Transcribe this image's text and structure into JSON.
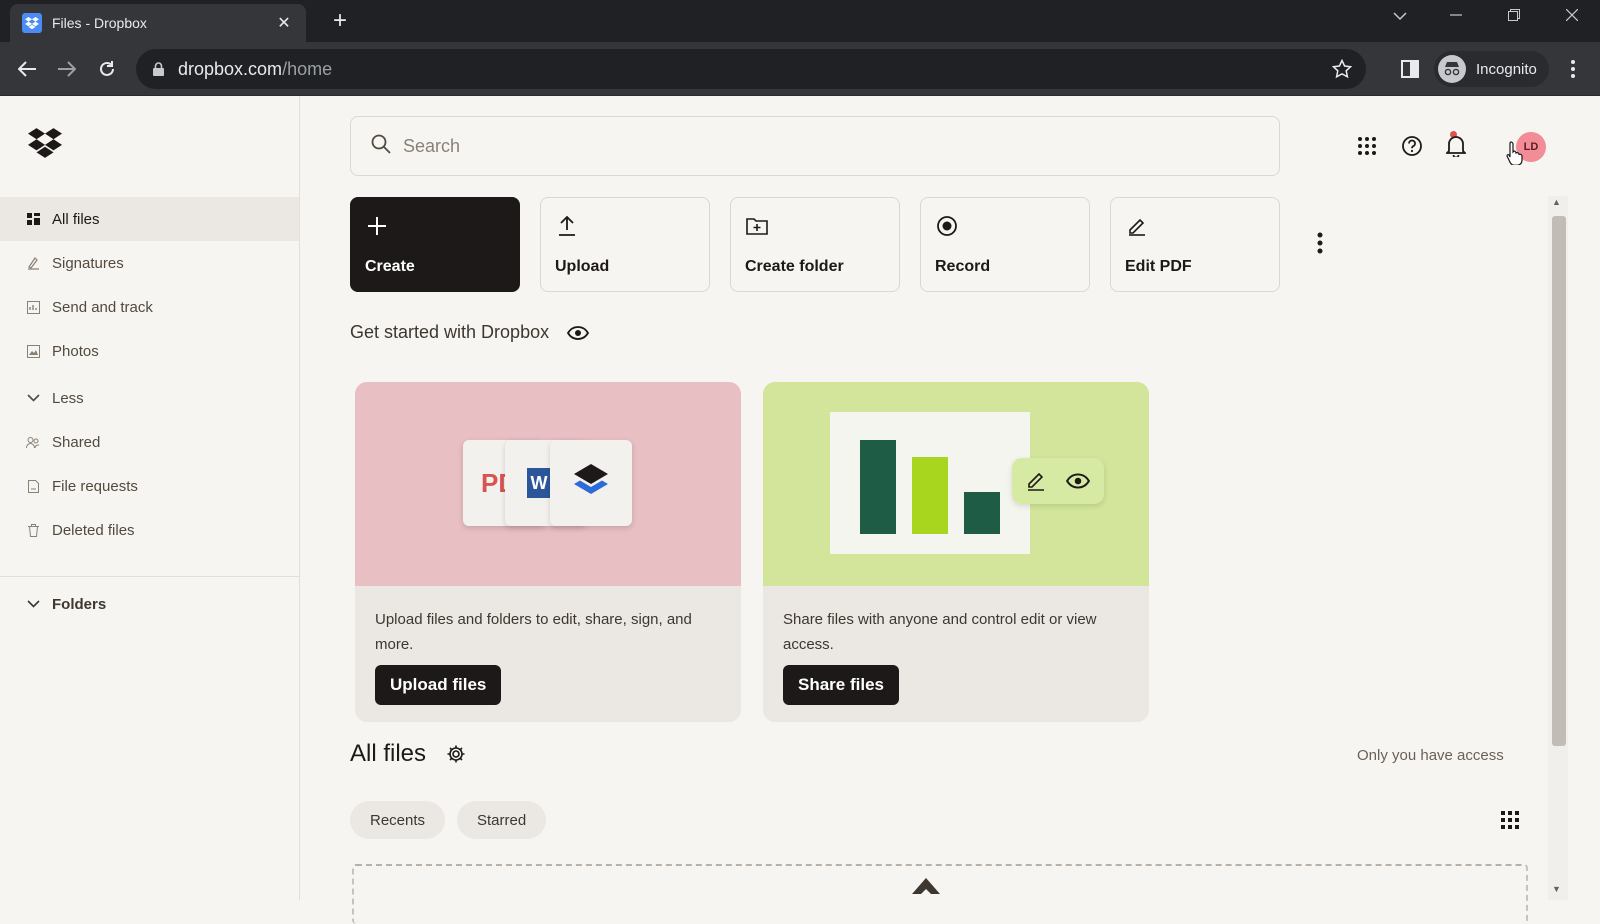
{
  "browser": {
    "tab_title": "Files - Dropbox",
    "tab_close": "✕",
    "new_tab": "+",
    "url_host": "dropbox.com",
    "url_path": "/home",
    "profile_label": "Incognito"
  },
  "sidebar": {
    "items": [
      {
        "label": "All files",
        "icon": "all-files-icon"
      },
      {
        "label": "Signatures",
        "icon": "signature-icon"
      },
      {
        "label": "Send and track",
        "icon": "send-track-icon"
      },
      {
        "label": "Photos",
        "icon": "photos-icon"
      },
      {
        "label": "Less",
        "icon": "chevron-down-icon"
      },
      {
        "label": "Shared",
        "icon": "shared-icon"
      },
      {
        "label": "File requests",
        "icon": "file-request-icon"
      },
      {
        "label": "Deleted files",
        "icon": "trash-icon"
      }
    ],
    "folders_label": "Folders"
  },
  "header": {
    "search_placeholder": "Search",
    "avatar_initials": "LD"
  },
  "actions": [
    {
      "label": "Create",
      "icon": "plus-icon"
    },
    {
      "label": "Upload",
      "icon": "upload-icon"
    },
    {
      "label": "Create folder",
      "icon": "folder-plus-icon"
    },
    {
      "label": "Record",
      "icon": "record-icon"
    },
    {
      "label": "Edit PDF",
      "icon": "pencil-icon"
    }
  ],
  "get_started": {
    "title": "Get started with Dropbox",
    "cards": [
      {
        "text": "Upload files and folders to edit, share, sign, and more.",
        "button": "Upload files",
        "bg": "#e8bfc3"
      },
      {
        "text": "Share files with anyone and control edit or view access.",
        "button": "Share files",
        "bg": "#d2e59a"
      }
    ],
    "doc_labels": [
      "PDF",
      "W"
    ]
  },
  "all_files": {
    "title": "All files",
    "access_note": "Only you have access",
    "chips": [
      "Recents",
      "Starred"
    ]
  },
  "colors": {
    "accent_dark": "#1e1919",
    "bar_dark": "#1f5c45",
    "bar_lime": "#a8d61f",
    "avatar": "#f28c96"
  }
}
